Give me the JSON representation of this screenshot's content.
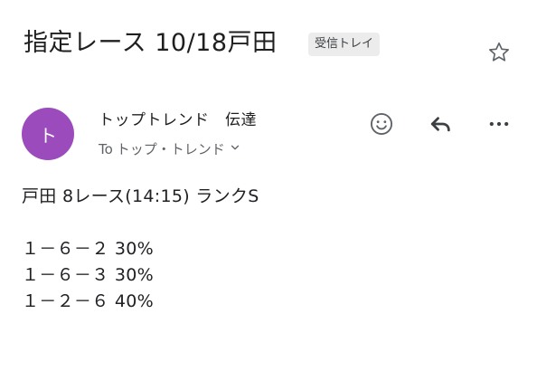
{
  "email": {
    "subject": "指定レース 10/18戸田",
    "label_badge": "受信トレイ",
    "sender_initial": "ト",
    "sender_name": "トップトレンド　伝達",
    "recipient_prefix": "To",
    "recipient_name": "トップ・トレンド",
    "body": {
      "header_line": "戸田 8レース(14:15) ランクS",
      "lines": [
        "１－６－２ 30%",
        "１－６－３ 30%",
        "１－２－６ 40%"
      ]
    }
  },
  "icons": {
    "star": "star-outline-icon",
    "emoji": "add-reaction-icon",
    "reply": "reply-icon",
    "more": "more-vert-icon",
    "expand": "chevron-down-icon"
  },
  "colors": {
    "avatar": "#9c4bbd",
    "badge_bg": "#ececec",
    "icon": "#5f6368"
  }
}
